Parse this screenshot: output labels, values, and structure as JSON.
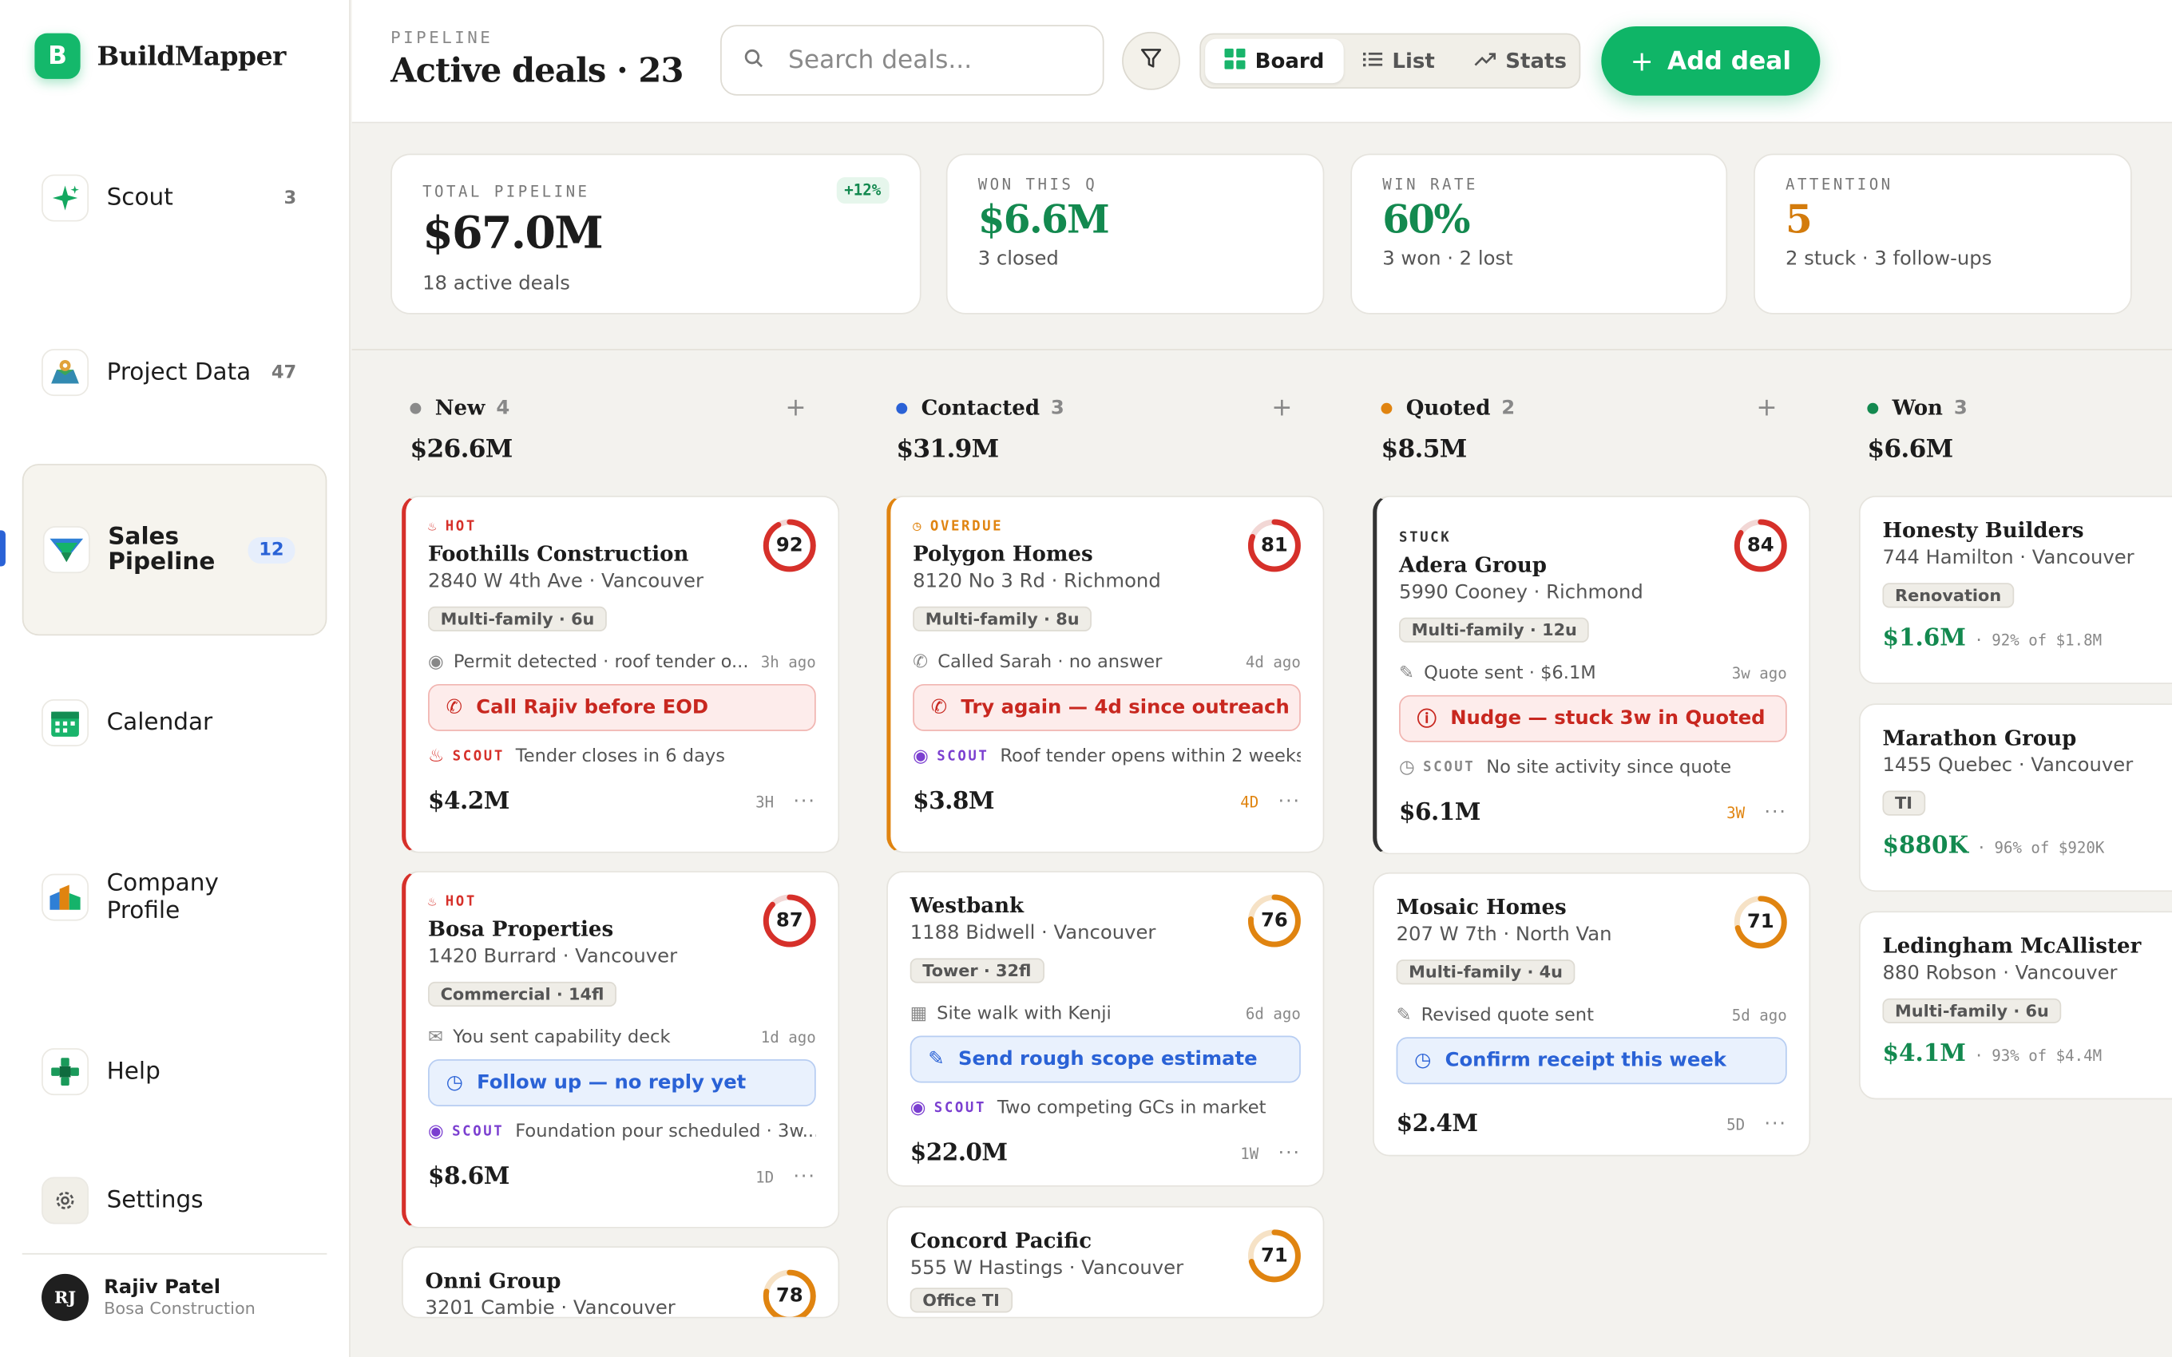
{
  "brand": {
    "logo_letter": "B",
    "name": "BuildMapper"
  },
  "sidebar": {
    "items": [
      {
        "label": "Scout",
        "count": "3",
        "icon": "sparkle-icon"
      },
      {
        "label": "Project Data",
        "count": "47",
        "icon": "map-icon"
      },
      {
        "label": "Sales Pipeline",
        "count": "12",
        "icon": "pipeline-icon"
      },
      {
        "label": "Calendar",
        "count": "",
        "icon": "calendar-icon"
      },
      {
        "label": "Company Profile",
        "count": "",
        "icon": "company-icon"
      },
      {
        "label": "Help",
        "count": "",
        "icon": "help-icon"
      },
      {
        "label": "Settings",
        "count": "",
        "icon": "gear-icon"
      }
    ],
    "user": {
      "initials": "RJ",
      "name": "Rajiv Patel",
      "company": "Bosa Construction"
    }
  },
  "header": {
    "eyebrow": "PIPELINE",
    "title": "Active deals · 23",
    "search_placeholder": "Search deals...",
    "views": [
      "Board",
      "List",
      "Stats"
    ],
    "add_label": "Add deal"
  },
  "stats": [
    {
      "label": "TOTAL PIPELINE",
      "value": "$67.0M",
      "sub": "18 active deals",
      "delta": "+12%"
    },
    {
      "label": "WON THIS Q",
      "value": "$6.6M",
      "sub": "3 closed"
    },
    {
      "label": "WIN RATE",
      "value": "60%",
      "sub": "3 won · 2 lost"
    },
    {
      "label": "ATTENTION",
      "value": "5",
      "sub": "2 stuck · 3 follow-ups"
    }
  ],
  "columns": [
    {
      "name": "New",
      "count": "4",
      "total": "$26.6M",
      "color": "#8a8a8a"
    },
    {
      "name": "Contacted",
      "count": "3",
      "total": "$31.9M",
      "color": "#2a62d6"
    },
    {
      "name": "Quoted",
      "count": "2",
      "total": "$8.5M",
      "color": "#e08410"
    },
    {
      "name": "Won",
      "count": "3",
      "total": "$6.6M",
      "color": "#13894f"
    }
  ],
  "cards": {
    "c1": {
      "flag": "HOT",
      "name": "Foothills Construction",
      "addr": "2840 W 4th Ave · Vancouver",
      "tag": "Multi-family · 6u",
      "activity": "Permit detected · roof tender o...",
      "activity_time": "3h ago",
      "action": "Call Rajiv before EOD",
      "scout": "SCOUT",
      "scout_text": "Tender closes in 6 days",
      "value": "$4.2M",
      "age": "3H",
      "score": "92"
    },
    "c2": {
      "flag": "HOT",
      "name": "Bosa Properties",
      "addr": "1420 Burrard · Vancouver",
      "tag": "Commercial · 14fl",
      "activity": "You sent capability deck",
      "activity_time": "1d ago",
      "action": "Follow up — no reply yet",
      "scout": "SCOUT",
      "scout_text": "Foundation pour scheduled · 3w...",
      "value": "$8.6M",
      "age": "1D",
      "score": "87"
    },
    "c3": {
      "name": "Onni Group",
      "addr": "3201 Cambie · Vancouver",
      "score": "78"
    },
    "c4": {
      "flag": "OVERDUE",
      "name": "Polygon Homes",
      "addr": "8120 No 3 Rd · Richmond",
      "tag": "Multi-family · 8u",
      "activity": "Called Sarah · no answer",
      "activity_time": "4d ago",
      "action": "Try again — 4d since outreach",
      "scout": "SCOUT",
      "scout_text": "Roof tender opens within 2 weeks",
      "value": "$3.8M",
      "age": "4D",
      "score": "81"
    },
    "c5": {
      "name": "Westbank",
      "addr": "1188 Bidwell · Vancouver",
      "tag": "Tower · 32fl",
      "activity": "Site walk with Kenji",
      "activity_time": "6d ago",
      "action": "Send rough scope estimate",
      "scout": "SCOUT",
      "scout_text": "Two competing GCs in market",
      "value": "$22.0M",
      "age": "1W",
      "score": "76"
    },
    "c6": {
      "name": "Concord Pacific",
      "addr": "555 W Hastings · Vancouver",
      "tag": "Office TI",
      "score": "71"
    },
    "c7": {
      "flag": "STUCK",
      "name": "Adera Group",
      "addr": "5990 Cooney · Richmond",
      "tag": "Multi-family · 12u",
      "activity": "Quote sent · $6.1M",
      "activity_time": "3w ago",
      "action": "Nudge — stuck 3w in Quoted",
      "scout": "SCOUT",
      "scout_text": "No site activity since quote",
      "value": "$6.1M",
      "age": "3W",
      "score": "84"
    },
    "c8": {
      "name": "Mosaic Homes",
      "addr": "207 W 7th · North Van",
      "tag": "Multi-family · 4u",
      "activity": "Revised quote sent",
      "activity_time": "5d ago",
      "action": "Confirm receipt this week",
      "value": "$2.4M",
      "age": "5D",
      "score": "71"
    },
    "w1": {
      "name": "Honesty Builders",
      "addr": "744 Hamilton · Vancouver",
      "tag": "Renovation",
      "value": "$1.6M",
      "sub": "92% of $1.8M"
    },
    "w2": {
      "name": "Marathon Group",
      "addr": "1455 Quebec · Vancouver",
      "tag": "TI",
      "value": "$880K",
      "sub": "96% of $920K"
    },
    "w3": {
      "name": "Ledingham McAllister",
      "addr": "880 Robson · Vancouver",
      "tag": "Multi-family · 6u",
      "value": "$4.1M",
      "sub": "93% of $4.4M"
    }
  },
  "colors": {
    "brand": "#14b86b",
    "hot": "#d6302a",
    "overdue": "#e08410",
    "link": "#2a62d6",
    "won": "#13894f",
    "scout": "#7b3fd0"
  }
}
